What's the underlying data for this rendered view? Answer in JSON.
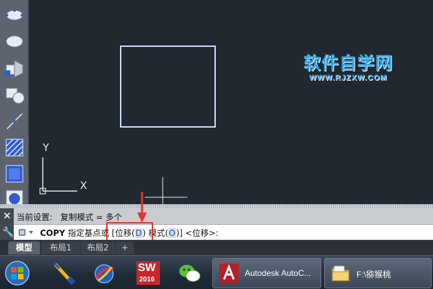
{
  "toolbar": {
    "tools": [
      {
        "icon": "ellipse-arc-icon"
      },
      {
        "icon": "ellipse-icon"
      },
      {
        "icon": "insert-block-icon"
      },
      {
        "icon": "make-block-icon"
      },
      {
        "icon": "point-icon"
      },
      {
        "icon": "hatch-icon"
      },
      {
        "icon": "gradient-icon"
      },
      {
        "icon": "region-icon"
      }
    ]
  },
  "canvas": {
    "background": "#212830",
    "rectangle_color": "#cfe0ff",
    "ucs": {
      "y_label": "Y",
      "x_label": "X"
    }
  },
  "watermark": {
    "title": "软件自学网",
    "url": "WWW.RJZXW.COM",
    "color": "#2fa5e8"
  },
  "command": {
    "history": "当前设置:   复制模式 = 多个",
    "line": {
      "command": "COPY",
      "prompt": "指定基点或",
      "open_bracket": "[",
      "option1_text": "位移(",
      "option1_key": "D",
      "option1_close": ")",
      "option2_text": "模式(",
      "option2_key": "O",
      "option2_close": ")",
      "close_bracket": "]",
      "default": "<位移>:"
    },
    "close_icon": "close-icon",
    "settings_icon": "wrench-icon"
  },
  "annotation": {
    "color": "#e8322f"
  },
  "tabs": [
    {
      "label": "模型",
      "active": true
    },
    {
      "label": "布局1",
      "active": false
    },
    {
      "label": "布局2",
      "active": false
    },
    {
      "label": "+",
      "active": false
    }
  ],
  "taskbar": {
    "start_icon": "windows-start-icon",
    "pinned": [
      {
        "icon": "paintbrush-app-icon"
      },
      {
        "icon": "globe-app-icon"
      },
      {
        "icon": "solidworks-icon",
        "badge": "SW",
        "year": "2016"
      },
      {
        "icon": "wechat-icon"
      }
    ],
    "tasks": [
      {
        "icon": "autocad-icon",
        "label": "Autodesk AutoC..."
      },
      {
        "icon": "folder-icon",
        "label": "F:\\猕猴桃"
      }
    ]
  }
}
